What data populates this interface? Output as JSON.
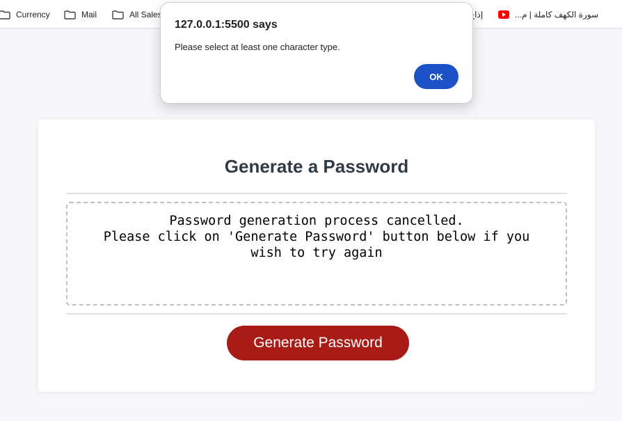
{
  "bookmarks": [
    {
      "label": "Currency",
      "icon": "folder-icon"
    },
    {
      "label": "Mail",
      "icon": "folder-icon"
    },
    {
      "label": "All Sales",
      "icon": "folder-icon"
    },
    {
      "label": "إذاع",
      "icon": ""
    },
    {
      "label": "سورة الكهف كاملة | م...",
      "icon": "youtube-icon"
    }
  ],
  "card": {
    "title": "Generate a Password",
    "password_output": "Password generation process cancelled.\nPlease click on 'Generate Password' button below if you wish to try again",
    "generate_button_label": "Generate Password"
  },
  "alert": {
    "origin": "127.0.0.1:5500 says",
    "message": "Please select at least one character type.",
    "ok_label": "OK"
  },
  "colors": {
    "page_background": "#f6f7fb",
    "title": "#2f3b46",
    "generate_button": "#a91b16",
    "alert_ok_button": "#1b52c7"
  }
}
